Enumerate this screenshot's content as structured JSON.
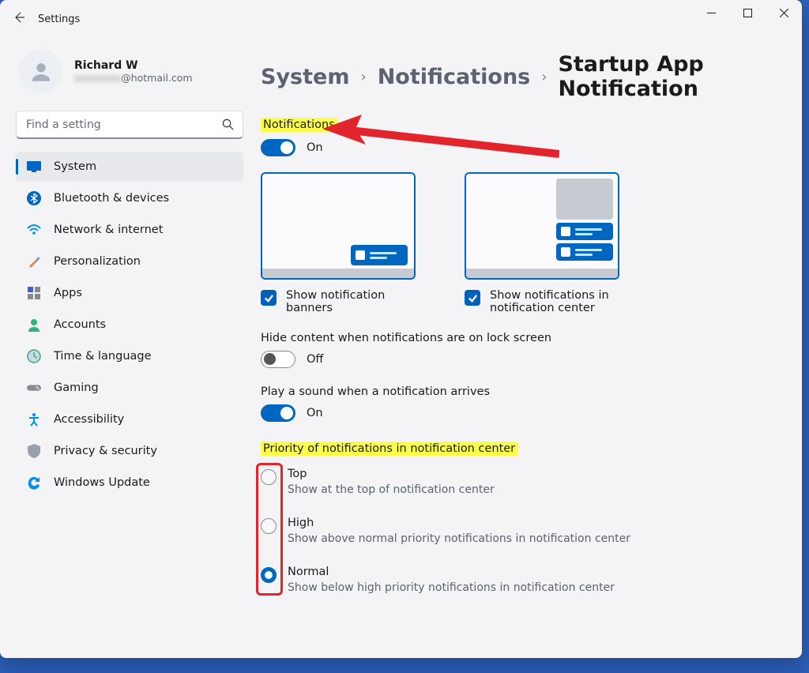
{
  "window": {
    "title": "Settings"
  },
  "user": {
    "name": "Richard W",
    "email_suffix": "@hotmail.com"
  },
  "search": {
    "placeholder": "Find a setting"
  },
  "sidebar": {
    "items": [
      {
        "label": "System"
      },
      {
        "label": "Bluetooth & devices"
      },
      {
        "label": "Network & internet"
      },
      {
        "label": "Personalization"
      },
      {
        "label": "Apps"
      },
      {
        "label": "Accounts"
      },
      {
        "label": "Time & language"
      },
      {
        "label": "Gaming"
      },
      {
        "label": "Accessibility"
      },
      {
        "label": "Privacy & security"
      },
      {
        "label": "Windows Update"
      }
    ],
    "active_index": 0
  },
  "breadcrumb": {
    "items": [
      "System",
      "Notifications",
      "Startup App Notification"
    ]
  },
  "main": {
    "notifications_label": "Notifications",
    "notifications_state": "On",
    "show_banners_label": "Show notification banners",
    "show_center_label": "Show notifications in notification center",
    "show_banners_checked": true,
    "show_center_checked": true,
    "hide_content_label": "Hide content when notifications are on lock screen",
    "hide_content_state": "Off",
    "play_sound_label": "Play a sound when a notification arrives",
    "play_sound_state": "On",
    "priority_label": "Priority of notifications in notification center",
    "priority_options": [
      {
        "title": "Top",
        "desc": "Show at the top of notification center"
      },
      {
        "title": "High",
        "desc": "Show above normal priority notifications in notification center"
      },
      {
        "title": "Normal",
        "desc": "Show below high priority notifications in notification center"
      }
    ],
    "priority_selected": 2
  }
}
